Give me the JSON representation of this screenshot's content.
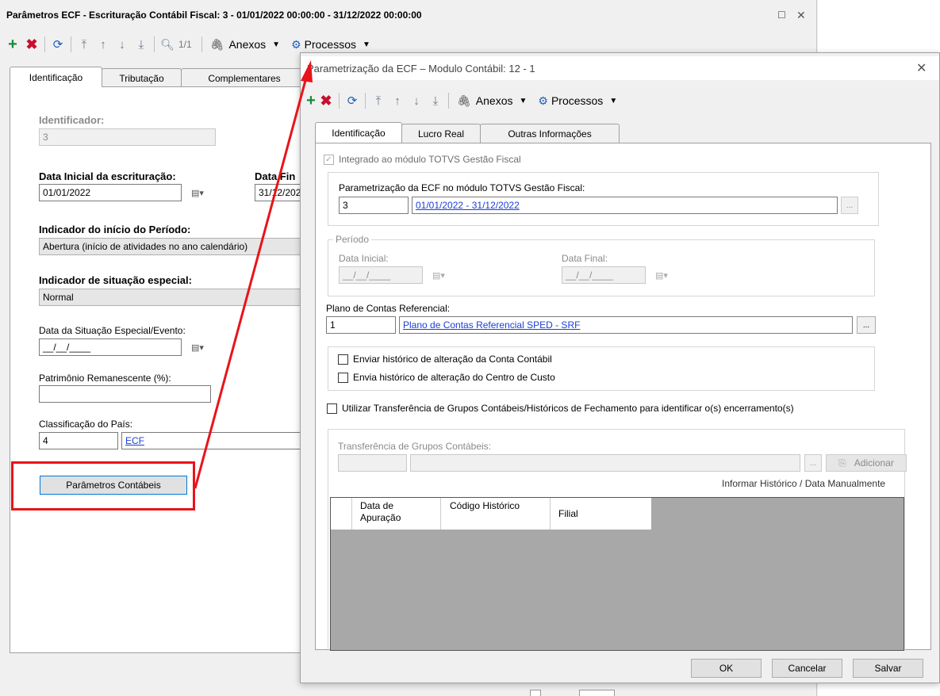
{
  "main_window": {
    "title": "Parâmetros ECF - Escrituração Contábil Fiscal: 3 - 01/01/2022 00:00:00 - 31/12/2022 00:00:00",
    "record_counter": "1/1",
    "anexos": "Anexos",
    "processos": "Processos",
    "tabs": [
      "Identificação",
      "Tributação",
      "Complementares"
    ],
    "identificador_label": "Identificador:",
    "identificador_value": "3",
    "data_inicial_label": "Data Inicial da escrituração:",
    "data_inicial_value": "01/01/2022",
    "data_final_label": "Data Fin",
    "data_final_value": "31/12/202",
    "indicador_inicio_label": "Indicador do início do Período:",
    "indicador_inicio_value": "Abertura (início de atividades no ano calendário)",
    "indicador_situacao_label": "Indicador de situação especial:",
    "indicador_situacao_value": "Normal",
    "data_situacao_label": "Data da Situação Especial/Evento:",
    "data_situacao_value": "__/__/____",
    "patrimonio_label": "Patrimônio Remanescente (%):",
    "patrimonio_value": "",
    "classificacao_label": "Classificação do País:",
    "classificacao_code": "4",
    "classificacao_link": "ECF",
    "parametros_button": "Parâmetros Contábeis"
  },
  "dialog": {
    "title": "Parametrização da ECF – Modulo Contábil: 12 - 1",
    "anexos": "Anexos",
    "processos": "Processos",
    "tabs": [
      "Identificação",
      "Lucro Real",
      "Outras Informações"
    ],
    "integrado_label": "Integrado ao módulo TOTVS Gestão Fiscal",
    "param_label": "Parametrização da ECF no módulo TOTVS Gestão Fiscal:",
    "param_code": "3",
    "param_link": "01/01/2022 - 31/12/2022",
    "periodo_label": "Período",
    "data_inicial_label": "Data Inicial:",
    "data_inicial_value": "__/__/____",
    "data_final_label": "Data Final:",
    "data_final_value": "__/__/____",
    "plano_label": "Plano de Contas Referencial:",
    "plano_code": "1",
    "plano_link": "Plano de Contas Referencial SPED - SRF",
    "enviar_hist_conta": "Enviar histórico de alteração da Conta Contábil",
    "enviar_hist_centro": "Envia histórico de alteração do Centro de Custo",
    "utilizar_transf": "Utilizar Transferência de Grupos Contábeis/Históricos de Fechamento para identificar o(s) encerramento(s)",
    "transf_label": "Transferência de Grupos Contábeis:",
    "adicionar": "Adicionar",
    "informar_hist": "Informar Histórico / Data Manualmente",
    "grid_headers": [
      "Data de Apuração",
      "Código Histórico",
      "Filial"
    ],
    "ellipsis": "...",
    "ok": "OK",
    "cancelar": "Cancelar",
    "salvar": "Salvar"
  },
  "colors": {
    "highlight_red": "#e8141a",
    "link_blue": "#1a3fd6",
    "add_green": "#1a8a3a",
    "delete_red": "#c8102e",
    "gear_blue": "#1e5fb8"
  }
}
